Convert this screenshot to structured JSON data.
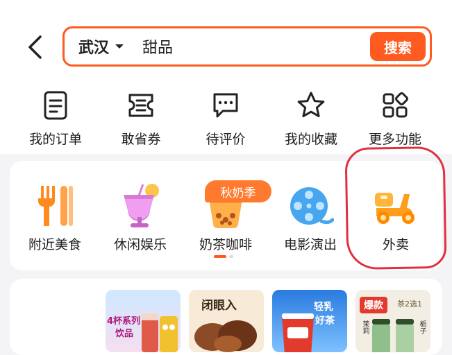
{
  "search": {
    "city": "武汉",
    "query": "甜品",
    "button": "搜索"
  },
  "quick_links": [
    {
      "label": "我的订单",
      "icon": "order-list-icon"
    },
    {
      "label": "敢省券",
      "icon": "coupon-icon"
    },
    {
      "label": "待评价",
      "icon": "comment-icon"
    },
    {
      "label": "我的收藏",
      "icon": "star-icon"
    },
    {
      "label": "更多功能",
      "icon": "grid-icon"
    }
  ],
  "categories": [
    {
      "label": "附近美食",
      "icon": "fork-icon"
    },
    {
      "label": "休闲娱乐",
      "icon": "cocktail-icon"
    },
    {
      "label": "奶茶咖啡",
      "icon": "milk-tea-icon"
    },
    {
      "label": "电影演出",
      "icon": "film-reel-icon"
    },
    {
      "label": "外卖",
      "icon": "scooter-icon"
    }
  ],
  "season_badge": "秋奶季",
  "pager": {
    "active": 0,
    "count": 2
  },
  "promos": [
    {
      "line1": "4杯系列",
      "line2": "饮品"
    },
    {
      "line1": "闭眼入"
    },
    {
      "line1": "轻乳",
      "line2": "好茶"
    },
    {
      "badge": "爆款",
      "tag": "茶2选1",
      "left": "茉莉",
      "right": "栀子"
    }
  ],
  "colors": {
    "accent": "#ff5a1f",
    "highlight_circle": "#e0303f",
    "icon_orange": "#ff8a1e"
  }
}
